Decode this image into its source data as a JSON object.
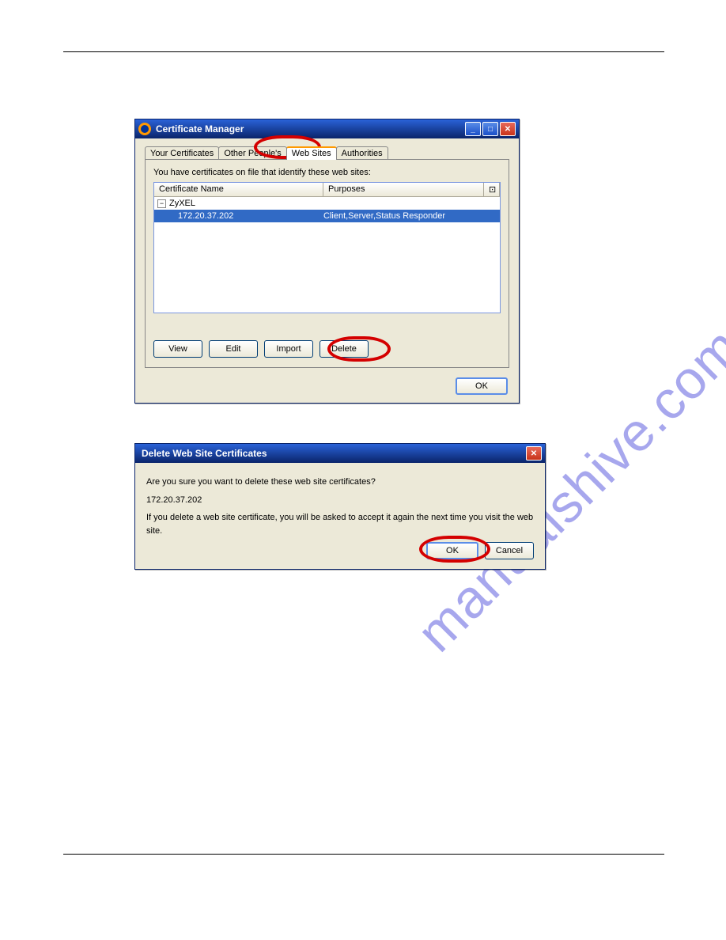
{
  "watermark": "manualshive.com",
  "certManager": {
    "title": "Certificate Manager",
    "controls": {
      "min": "_",
      "max": "□",
      "close": "✕"
    },
    "tabs": {
      "yourCerts": "Your Certificates",
      "otherPeople": "Other People's",
      "webSites": "Web Sites",
      "authorities": "Authorities"
    },
    "instruction": "You have certificates on file that identify these web sites:",
    "columns": {
      "name": "Certificate Name",
      "purposes": "Purposes",
      "end": "⊡"
    },
    "groupName": "ZyXEL",
    "toggle": "−",
    "row": {
      "name": "172.20.37.202",
      "purposes": "Client,Server,Status Responder"
    },
    "buttons": {
      "view": "View",
      "edit": "Edit",
      "import": "Import",
      "delete": "Delete",
      "ok": "OK"
    }
  },
  "deleteDialog": {
    "title": "Delete Web Site Certificates",
    "close": "✕",
    "q": "Are you sure you want to delete these web site certificates?",
    "item": "172.20.37.202",
    "note": "If you delete a web site certificate, you will be asked to accept it again the next time you visit the web site.",
    "ok": "OK",
    "cancel": "Cancel"
  }
}
